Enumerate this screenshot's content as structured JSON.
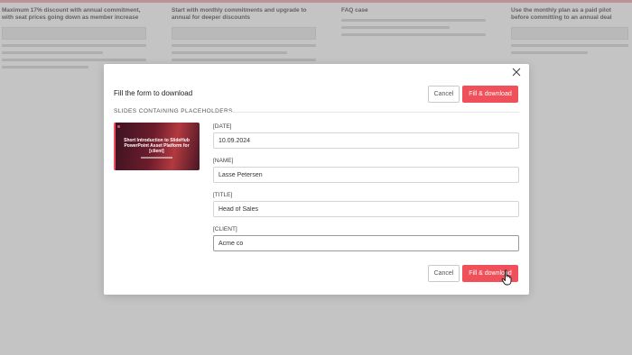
{
  "background": {
    "columns": [
      {
        "heading": "Maximum 17% discount with annual commitment, with seat prices going down as member increase"
      },
      {
        "heading": "Start with monthly commitments and upgrade to annual for deeper discounts"
      },
      {
        "heading": "FAQ case"
      },
      {
        "heading": "Use the monthly plan as a paid pilot before committing to an annual deal"
      }
    ]
  },
  "modal": {
    "title": "Fill the form to download",
    "section_label": "SLIDES CONTAINING PLACEHOLDERS",
    "cancel_label": "Cancel",
    "primary_label": "Fill & download",
    "thumbnail_text": "Short Introduction to SlideHub PowerPoint Asset Platform for [client]",
    "fields": [
      {
        "label": "[DATE]",
        "value": "10.09.2024"
      },
      {
        "label": "[NAME]",
        "value": "Lasse Petersen"
      },
      {
        "label": "[TITLE]",
        "value": "Head of Sales"
      },
      {
        "label": "[CLIENT]",
        "value": "Acme co"
      }
    ]
  },
  "colors": {
    "accent": "#f0505a"
  },
  "icons": {
    "close": "close-icon",
    "pointer": "hand-pointer-icon"
  }
}
